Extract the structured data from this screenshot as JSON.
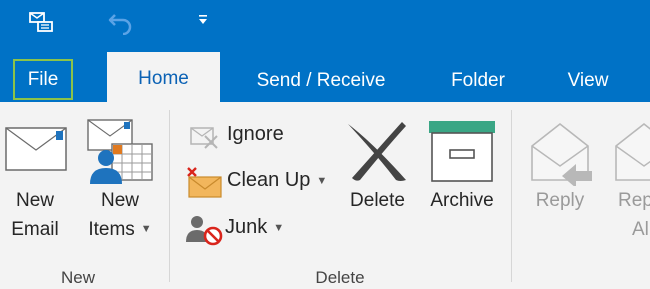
{
  "tabs": {
    "file": "File",
    "home": "Home",
    "send_receive": "Send / Receive",
    "folder": "Folder",
    "view": "View"
  },
  "new_group": {
    "new_email_line1": "New",
    "new_email_line2": "Email",
    "new_items_line1": "New",
    "new_items_line2": "Items",
    "label": "New"
  },
  "delete_group": {
    "ignore": "Ignore",
    "clean_up": "Clean Up",
    "junk": "Junk",
    "delete": "Delete",
    "archive": "Archive",
    "label": "Delete"
  },
  "respond_group": {
    "reply": "Reply",
    "reply_all_line1": "Rep",
    "reply_all_line2": "Al"
  },
  "colors": {
    "accent": "#0072c6",
    "file_border": "#8bc34a"
  }
}
